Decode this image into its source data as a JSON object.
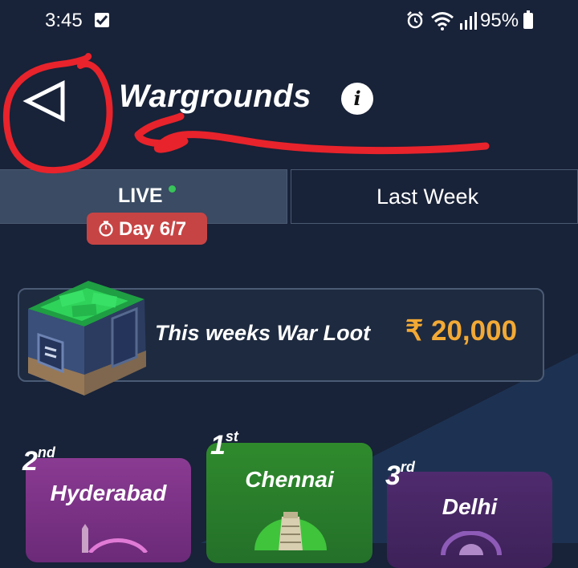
{
  "status_bar": {
    "time": "3:45",
    "battery": "95%",
    "icons": [
      "notification-check-icon",
      "alarm-icon",
      "wifi-icon",
      "signal-icon",
      "battery-icon"
    ]
  },
  "header": {
    "title": "Wargrounds",
    "info_label": "i",
    "back_icon": "back-triangle-icon"
  },
  "tabs": [
    {
      "label": "LIVE",
      "active": true,
      "live_dot_color": "#39c35a"
    },
    {
      "label": "Last Week",
      "active": false
    }
  ],
  "day_badge": {
    "text": "Day 6/7",
    "icon": "timer-icon",
    "color": "#c74444"
  },
  "loot": {
    "text": "This weeks War Loot",
    "amount": "₹ 20,000",
    "amount_color": "#f2a935",
    "icon": "treasure-chest-icon"
  },
  "leaderboard": [
    {
      "rank": "2",
      "suffix": "nd",
      "city": "Hyderabad",
      "color": "#8a3a92"
    },
    {
      "rank": "1",
      "suffix": "st",
      "city": "Chennai",
      "color": "#2f8a2c"
    },
    {
      "rank": "3",
      "suffix": "rd",
      "city": "Delhi",
      "color": "#4f2b6e"
    }
  ],
  "colors": {
    "background": "#182238",
    "annotation": "#e8232b"
  }
}
